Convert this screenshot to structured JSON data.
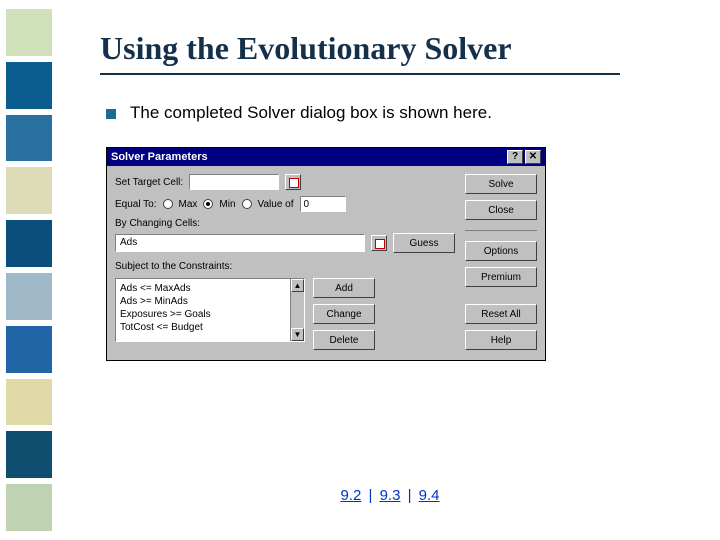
{
  "slide": {
    "title": "Using the Evolutionary Solver",
    "bullet": "The completed Solver dialog box is shown here."
  },
  "dialog": {
    "title": "Solver Parameters",
    "help_btn": "?",
    "close_btn": "✕",
    "labels": {
      "set_target": "Set Target Cell:",
      "equal_to": "Equal To:",
      "max": "Max",
      "min": "Min",
      "value_of": "Value of",
      "by_changing": "By Changing Cells:",
      "subject": "Subject to the Constraints:"
    },
    "inputs": {
      "target_cell": "",
      "value_of": "0",
      "changing_cells": "Ads"
    },
    "radio_selected": "min",
    "constraints": [
      "Ads <= MaxAds",
      "Ads >= MinAds",
      "Exposures >= Goals",
      "TotCost <= Budget"
    ],
    "buttons": {
      "solve": "Solve",
      "close": "Close",
      "options": "Options",
      "premium": "Premium",
      "guess": "Guess",
      "add": "Add",
      "change": "Change",
      "delete": "Delete",
      "reset": "Reset All",
      "help": "Help"
    }
  },
  "footer": {
    "links": [
      "9.2",
      "9.3",
      "9.4"
    ],
    "sep": "|"
  }
}
